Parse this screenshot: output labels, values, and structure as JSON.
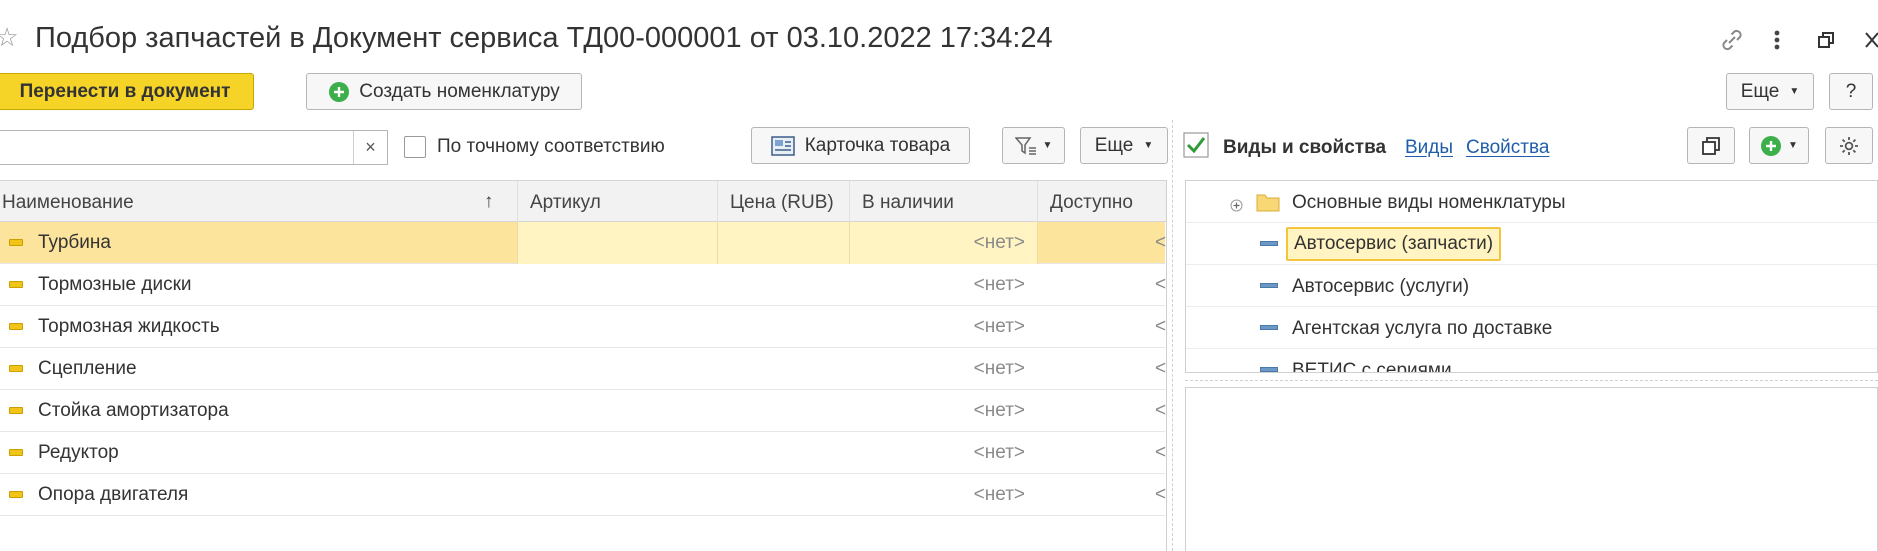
{
  "window": {
    "title": "Подбор запчастей в Документ сервиса ТД00-000001 от 03.10.2022 17:34:24"
  },
  "toolbar": {
    "transfer_label": "Перенести в документ",
    "create_label": "Создать номенклатуру",
    "more_label": "Еще",
    "help_label": "?"
  },
  "search": {
    "value": "",
    "clear_label": "×",
    "exact_label": "По точному соответствию",
    "card_label": "Карточка товара",
    "more_label": "Еще"
  },
  "table": {
    "columns": [
      "Наименование",
      "Артикул",
      "Цена (RUB)",
      "В наличии",
      "Доступно"
    ],
    "sort_glyph": "↑",
    "rows": [
      {
        "name": "Турбина",
        "stock": "<нет>",
        "available": "<"
      },
      {
        "name": "Тормозные диски",
        "stock": "<нет>",
        "available": "<"
      },
      {
        "name": "Тормозная жидкость",
        "stock": "<нет>",
        "available": "<"
      },
      {
        "name": "Сцепление",
        "stock": "<нет>",
        "available": "<"
      },
      {
        "name": "Стойка амортизатора",
        "stock": "<нет>",
        "available": "<"
      },
      {
        "name": "Редуктор",
        "stock": "<нет>",
        "available": "<"
      },
      {
        "name": "Опора двигателя",
        "stock": "<нет>",
        "available": "<"
      }
    ]
  },
  "right_panel": {
    "title": "Виды и свойства",
    "link_kinds": "Виды",
    "link_props": "Свойства",
    "tree": [
      "Основные виды номенклатуры",
      "Автосервис (запчасти)",
      "Автосервис (услуги)",
      "Агентская услуга по доставке",
      "ВЕТИС с сериями"
    ]
  },
  "colors": {
    "accent_button": "#f5d327",
    "selected_row": "#fde49c",
    "selected_tree": "#fff4c2",
    "link": "#1f5fa9",
    "check": "#2f9a38"
  }
}
